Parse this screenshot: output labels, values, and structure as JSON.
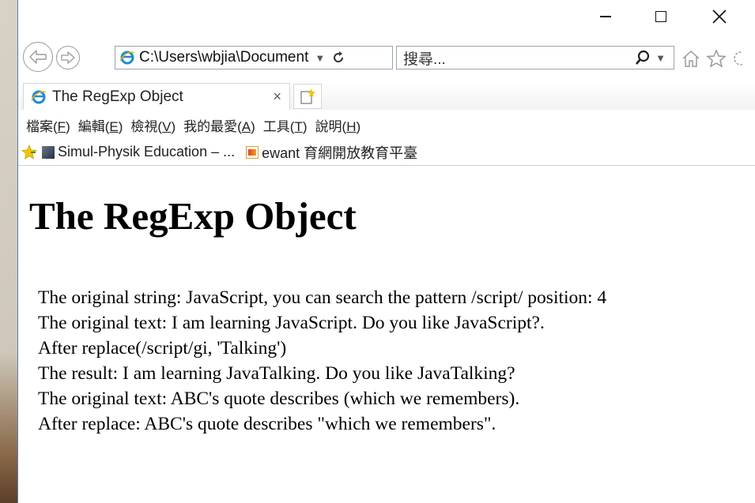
{
  "browser": {
    "address": "C:\\Users\\wbjia\\Document",
    "search_placeholder": "搜尋...",
    "tab_title": "The RegExp Object",
    "tab_close": "×",
    "menu": [
      {
        "label": "檔案(",
        "key": "F",
        "end": ")"
      },
      {
        "label": "編輯(",
        "key": "E",
        "end": ")"
      },
      {
        "label": "檢視(",
        "key": "V",
        "end": ")"
      },
      {
        "label": "我的最愛(",
        "key": "A",
        "end": ")"
      },
      {
        "label": "工具(",
        "key": "T",
        "end": ")"
      },
      {
        "label": "說明(",
        "key": "H",
        "end": ")"
      }
    ],
    "favorites": [
      {
        "label": "Simul-Physik Education – ..."
      },
      {
        "label": "ewant 育網開放教育平臺"
      }
    ],
    "colors": {
      "accent": "#1e73be",
      "ie_logo": "#1e8ad6"
    }
  },
  "page": {
    "heading": "The RegExp Object",
    "lines": [
      "The original string: JavaScript, you can search the pattern /script/ position: 4",
      "The original text: I am learning JavaScript. Do you like JavaScript?.",
      "After replace(/script/gi, 'Talking')",
      "The result: I am learning JavaTalking. Do you like JavaTalking?",
      "The original text: ABC's quote describes (which we remembers).",
      "After replace: ABC's quote describes \"which we remembers\"."
    ]
  }
}
